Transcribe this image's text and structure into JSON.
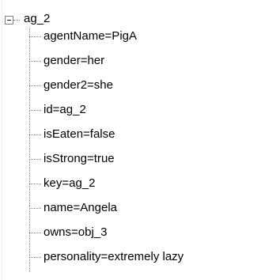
{
  "tree": {
    "root": {
      "label": "ag_2",
      "expanded": true,
      "expander_icon": "minus-box-icon"
    },
    "children": [
      {
        "label": "agentName=PigA"
      },
      {
        "label": "gender=her"
      },
      {
        "label": "gender2=she"
      },
      {
        "label": "id=ag_2"
      },
      {
        "label": "isEaten=false"
      },
      {
        "label": "isStrong=true"
      },
      {
        "label": "key=ag_2"
      },
      {
        "label": "name=Angela"
      },
      {
        "label": "owns=obj_3"
      },
      {
        "label": "personality=extremely lazy"
      }
    ]
  },
  "colors": {
    "background": "#ffffff",
    "text": "#000000",
    "connector_lines": "#808080"
  }
}
